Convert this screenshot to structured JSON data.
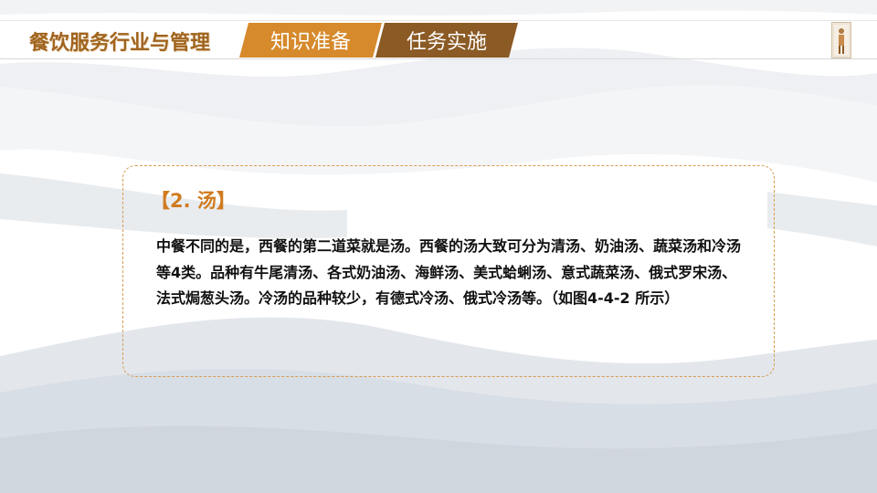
{
  "header": {
    "course_title": "餐饮服务行业与管理",
    "tabs": [
      {
        "label": "知识准备",
        "color": "#d68a2c"
      },
      {
        "label": "任务实施",
        "color": "#8b5a25"
      }
    ]
  },
  "content": {
    "heading": "【2. 汤】",
    "body": "中餐不同的是，西餐的第二道菜就是汤。西餐的汤大致可分为清汤、奶油汤、蔬菜汤和冷汤等4类。品种有牛尾清汤、各式奶油汤、海鲜汤、美式蛤蜊汤、意式蔬菜汤、俄式罗宋汤、法式焗葱头汤。冷汤的品种较少，有德式冷汤、俄式冷汤等。（如图4-4-2 所示）"
  },
  "colors": {
    "accent": "#d07b20",
    "dark_accent": "#8b5a25",
    "title": "#a0641e"
  }
}
